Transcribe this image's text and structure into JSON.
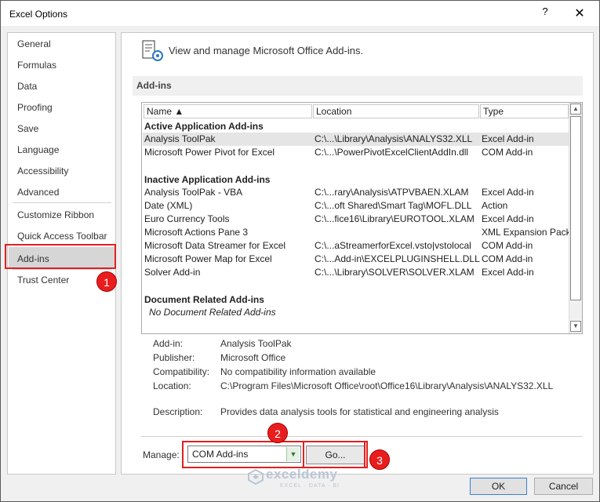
{
  "window": {
    "title": "Excel Options",
    "help": "?",
    "close": "✕"
  },
  "sidebar": {
    "items": [
      {
        "label": "General"
      },
      {
        "label": "Formulas"
      },
      {
        "label": "Data"
      },
      {
        "label": "Proofing"
      },
      {
        "label": "Save"
      },
      {
        "label": "Language"
      },
      {
        "label": "Accessibility"
      },
      {
        "label": "Advanced"
      },
      {
        "label": "Customize Ribbon"
      },
      {
        "label": "Quick Access Toolbar"
      },
      {
        "label": "Add-ins",
        "selected": true
      },
      {
        "label": "Trust Center"
      }
    ]
  },
  "main": {
    "header": "View and manage Microsoft Office Add-ins.",
    "section": "Add-ins",
    "columns": {
      "name": "Name ▲",
      "location": "Location",
      "type": "Type"
    },
    "groups": {
      "active": "Active Application Add-ins",
      "inactive": "Inactive Application Add-ins",
      "document": "Document Related Add-ins",
      "document_empty": "No Document Related Add-ins"
    },
    "active_rows": [
      {
        "name": "Analysis ToolPak",
        "location": "C:\\...\\Library\\Analysis\\ANALYS32.XLL",
        "type": "Excel Add-in"
      },
      {
        "name": "Microsoft Power Pivot for Excel",
        "location": "C:\\...\\PowerPivotExcelClientAddIn.dll",
        "type": "COM Add-in"
      }
    ],
    "inactive_rows": [
      {
        "name": "Analysis ToolPak - VBA",
        "location": "C:\\...rary\\Analysis\\ATPVBAEN.XLAM",
        "type": "Excel Add-in"
      },
      {
        "name": "Date (XML)",
        "location": "C:\\...oft Shared\\Smart Tag\\MOFL.DLL",
        "type": "Action"
      },
      {
        "name": "Euro Currency Tools",
        "location": "C:\\...fice16\\Library\\EUROTOOL.XLAM",
        "type": "Excel Add-in"
      },
      {
        "name": "Microsoft Actions Pane 3",
        "location": "",
        "type": "XML Expansion Pack"
      },
      {
        "name": "Microsoft Data Streamer for Excel",
        "location": "C:\\...aStreamerforExcel.vsto|vstolocal",
        "type": "COM Add-in"
      },
      {
        "name": "Microsoft Power Map for Excel",
        "location": "C:\\...Add-in\\EXCELPLUGINSHELL.DLL",
        "type": "COM Add-in"
      },
      {
        "name": "Solver Add-in",
        "location": "C:\\...\\Library\\SOLVER\\SOLVER.XLAM",
        "type": "Excel Add-in"
      }
    ],
    "details": {
      "addin_label": "Add-in:",
      "addin": "Analysis ToolPak",
      "publisher_label": "Publisher:",
      "publisher": "Microsoft Office",
      "compat_label": "Compatibility:",
      "compat": "No compatibility information available",
      "location_label": "Location:",
      "location": "C:\\Program Files\\Microsoft Office\\root\\Office16\\Library\\Analysis\\ANALYS32.XLL",
      "desc_label": "Description:",
      "desc": "Provides data analysis tools for statistical and engineering analysis"
    },
    "manage": {
      "label": "Manage:",
      "value": "COM Add-ins",
      "go": "Go..."
    }
  },
  "badges": [
    "1",
    "2",
    "3"
  ],
  "watermark": {
    "name": "exceldemy",
    "sub": "EXCEL · DATA · BI"
  },
  "footer": {
    "ok": "OK",
    "cancel": "Cancel"
  }
}
